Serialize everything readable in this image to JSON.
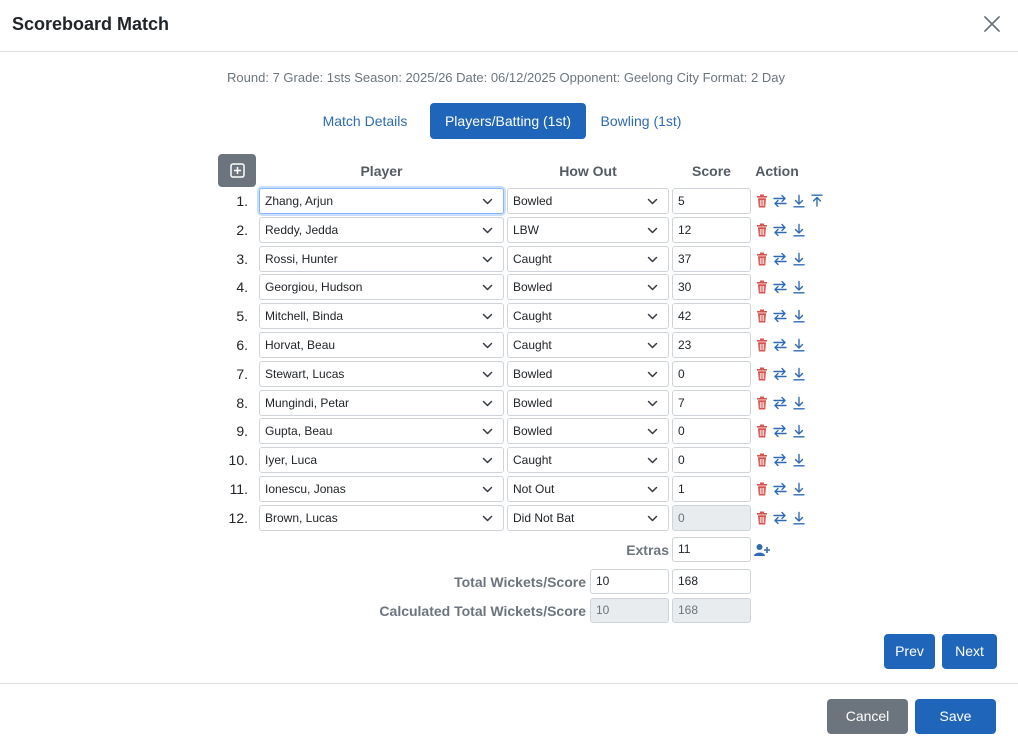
{
  "modal": {
    "title": "Scoreboard Match",
    "close_icon": "close-icon"
  },
  "info_line": "Round: 7 Grade: 1sts Season: 2025/26 Date: 06/12/2025 Opponent: Geelong City Format: 2 Day",
  "tabs": [
    {
      "label": "Match Details",
      "active": false
    },
    {
      "label": "Players/Batting (1st)",
      "active": true
    },
    {
      "label": "Bowling (1st)",
      "active": false
    }
  ],
  "table": {
    "add_row_icon": "plus-square-icon",
    "headers": {
      "player": "Player",
      "how_out": "How Out",
      "score": "Score",
      "action": "Action"
    },
    "rows": [
      {
        "num": "1.",
        "player": "Zhang, Arjun",
        "how_out": "Bowled",
        "score": "5",
        "score_disabled": false
      },
      {
        "num": "2.",
        "player": "Reddy, Jedda",
        "how_out": "LBW",
        "score": "12",
        "score_disabled": false
      },
      {
        "num": "3.",
        "player": "Rossi, Hunter",
        "how_out": "Caught",
        "score": "37",
        "score_disabled": false
      },
      {
        "num": "4.",
        "player": "Georgiou, Hudson",
        "how_out": "Bowled",
        "score": "30",
        "score_disabled": false
      },
      {
        "num": "5.",
        "player": "Mitchell, Binda",
        "how_out": "Caught",
        "score": "42",
        "score_disabled": false
      },
      {
        "num": "6.",
        "player": "Horvat, Beau",
        "how_out": "Caught",
        "score": "23",
        "score_disabled": false
      },
      {
        "num": "7.",
        "player": "Stewart, Lucas",
        "how_out": "Bowled",
        "score": "0",
        "score_disabled": false
      },
      {
        "num": "8.",
        "player": "Mungindi, Petar",
        "how_out": "Bowled",
        "score": "7",
        "score_disabled": false
      },
      {
        "num": "9.",
        "player": "Gupta, Beau",
        "how_out": "Bowled",
        "score": "0",
        "score_disabled": false
      },
      {
        "num": "10.",
        "player": "Iyer, Luca",
        "how_out": "Caught",
        "score": "0",
        "score_disabled": false
      },
      {
        "num": "11.",
        "player": "Ionescu, Jonas",
        "how_out": "Not Out",
        "score": "1",
        "score_disabled": false
      },
      {
        "num": "12.",
        "player": "Brown, Lucas",
        "how_out": "Did Not Bat",
        "score": "0",
        "score_disabled": true
      }
    ]
  },
  "extras": {
    "label": "Extras",
    "value": "11",
    "icon": "add-user-icon"
  },
  "total": {
    "label": "Total Wickets/Score",
    "wickets": "10",
    "score": "168"
  },
  "calculated": {
    "label": "Calculated Total Wickets/Score",
    "wickets": "10",
    "score": "168"
  },
  "nav": {
    "prev": "Prev",
    "next": "Next"
  },
  "footer": {
    "cancel": "Cancel",
    "save": "Save"
  },
  "colors": {
    "primary": "#1f65b9",
    "secondary": "#6c757d",
    "delete": "#d9534f",
    "action_blue": "#2f6bb4"
  }
}
